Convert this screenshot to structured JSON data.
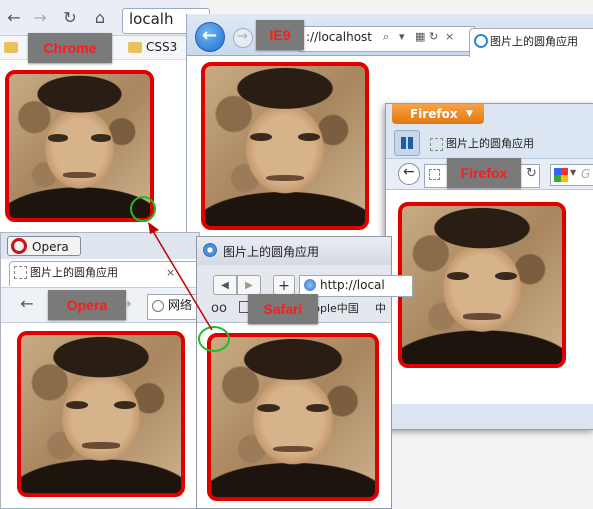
{
  "chrome": {
    "label": "Chrome",
    "address": "localh",
    "bookmark": "CSS3",
    "nav": {
      "back": "←",
      "forward": "→",
      "reload": "↻",
      "home": "⌂"
    }
  },
  "ie9": {
    "label": "IE9",
    "address": "://localhost",
    "tab_title": "图片上的圆角应用",
    "icons": [
      "back-arrow-icon",
      "forward-arrow-icon",
      "search-icon",
      "dropdown-icon",
      "compat-icon",
      "refresh-icon",
      "close-icon",
      "ie-logo-icon"
    ]
  },
  "firefox": {
    "label": "Firefox",
    "menu_button": "Firefox",
    "tab_title": "图片上的圆角应用",
    "google_letter": "G"
  },
  "opera": {
    "label": "Opera",
    "menu_button": "Opera",
    "tab_title": "图片上的圆角应用",
    "close": "×",
    "address_prefix": "网络"
  },
  "safari": {
    "label": "Safari",
    "window_title": "图片上的圆角应用",
    "address": "http://local",
    "bookmarks_partial": "pple中国",
    "bookmarks_more": "中"
  },
  "colors": {
    "photo_border": "#e00000",
    "label_bg": "#7a7a7a",
    "label_text": "#ff1a1a",
    "highlight_circle": "#22bb22",
    "arrow": "#c00000"
  }
}
